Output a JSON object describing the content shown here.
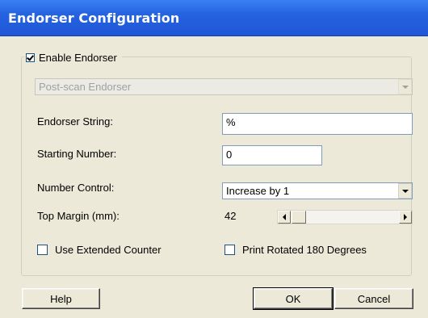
{
  "window": {
    "title": "Endorser Configuration"
  },
  "enable_endorser": {
    "label": "Enable Endorser",
    "checked": true
  },
  "endorser_type": {
    "value": "Post-scan Endorser",
    "disabled": true
  },
  "endorser_string": {
    "label": "Endorser String:",
    "value": "%"
  },
  "starting_number": {
    "label": "Starting Number:",
    "value": "0"
  },
  "number_control": {
    "label": "Number Control:",
    "value": "Increase by 1"
  },
  "top_margin": {
    "label": "Top Margin (mm):",
    "value": "42"
  },
  "use_extended_counter": {
    "label": "Use Extended Counter",
    "checked": false
  },
  "print_rotated": {
    "label": "Print Rotated 180 Degrees",
    "checked": false
  },
  "buttons": {
    "help": "Help",
    "ok": "OK",
    "cancel": "Cancel"
  },
  "icons": {
    "combo_arrow": "chevron-down-icon",
    "scroll_left": "arrow-left-icon",
    "scroll_right": "arrow-right-icon"
  },
  "colors": {
    "titlebar": "#2563e0",
    "dialog_bg": "#ece9d8",
    "input_border": "#7f9db9"
  }
}
